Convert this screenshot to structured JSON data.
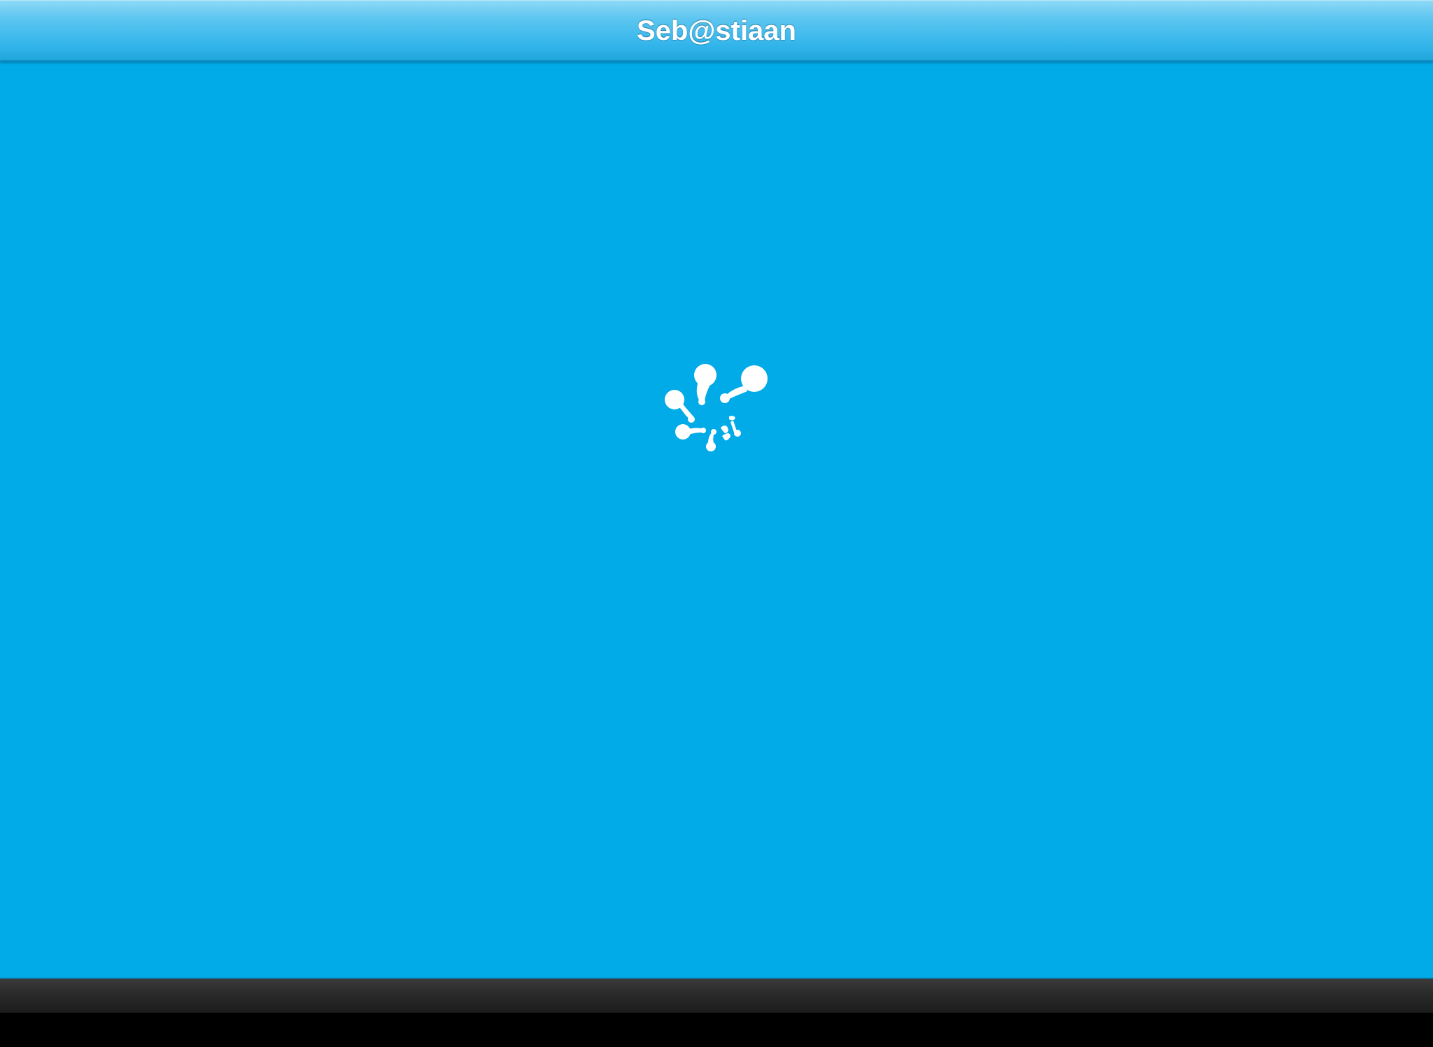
{
  "app": {
    "title": "Seb@stiaan"
  },
  "loading_indicator": {
    "icon": "loading-blob-icon"
  },
  "colors": {
    "background": "#01ABE8",
    "title_bar_top": "#8ED9F6",
    "title_bar_bottom": "#1FA6DB",
    "title_text": "#FFFFFF",
    "toolbar": "#2A2A2A",
    "bottom_edge": "#000000"
  }
}
